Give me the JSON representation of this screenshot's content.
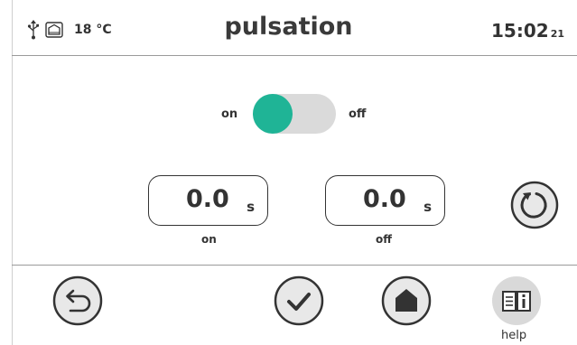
{
  "header": {
    "temperature": "18 °C",
    "title": "pulsation",
    "time": "15:02",
    "seconds": "21"
  },
  "toggle": {
    "on_label": "on",
    "off_label": "off",
    "state": "on",
    "active_color": "#1fb496"
  },
  "fields": {
    "on_value": "0.0",
    "on_unit": "s",
    "on_label": "on",
    "off_value": "0.0",
    "off_unit": "s",
    "off_label": "off"
  },
  "footer": {
    "help_label": "help"
  },
  "icons": [
    "usb-icon",
    "external-sensor-icon",
    "reset-icon",
    "back-icon",
    "confirm-icon",
    "home-icon",
    "help-book-icon"
  ]
}
